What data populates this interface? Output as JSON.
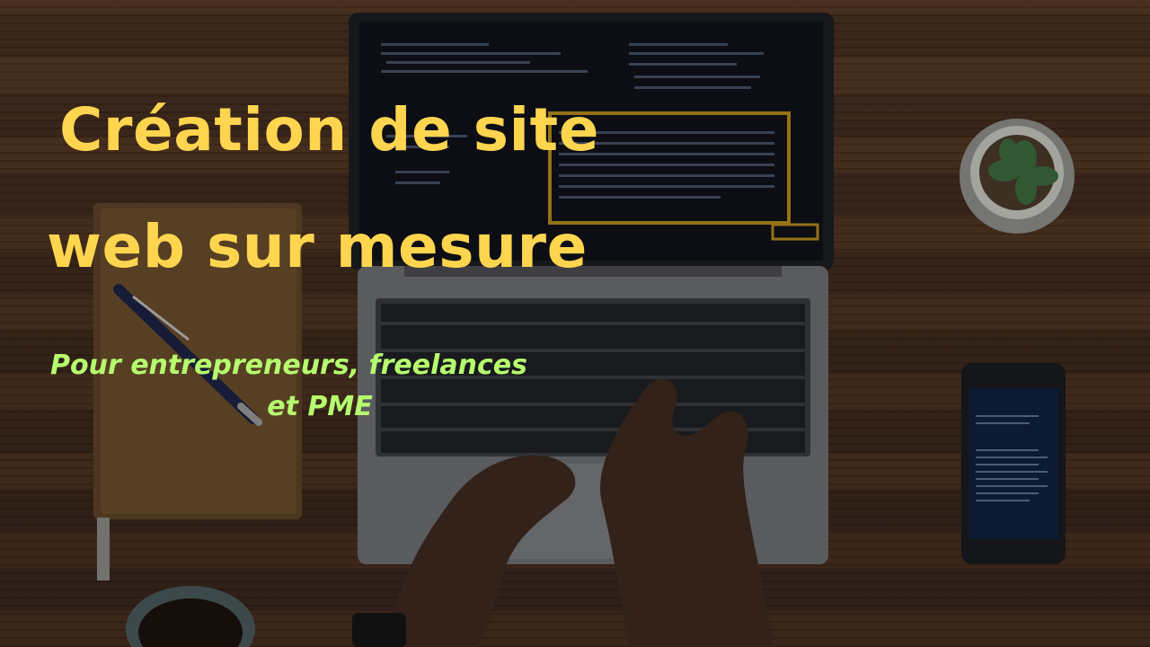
{
  "headline": {
    "line1": "Création de site",
    "line2": "web sur mesure"
  },
  "subtitle": {
    "line1": "Pour entrepreneurs, freelances",
    "line2": "et PME"
  },
  "colors": {
    "headline": "#ffd54f",
    "subtitle": "#b6ff6e",
    "wood": "#3c281b"
  }
}
